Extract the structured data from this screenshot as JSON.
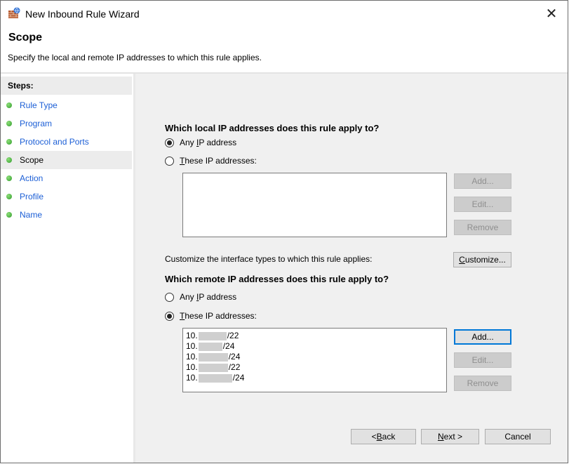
{
  "window": {
    "title": "New Inbound Rule Wizard"
  },
  "header": {
    "title": "Scope",
    "description": "Specify the local and remote IP addresses to which this rule applies."
  },
  "steps": {
    "heading": "Steps:",
    "items": [
      {
        "label": "Rule Type"
      },
      {
        "label": "Program"
      },
      {
        "label": "Protocol and Ports"
      },
      {
        "label": "Scope"
      },
      {
        "label": "Action"
      },
      {
        "label": "Profile"
      },
      {
        "label": "Name"
      }
    ],
    "current": "Scope"
  },
  "local": {
    "question": "Which local IP addresses does this rule apply to?",
    "any_prefix": "Any ",
    "any_u": "I",
    "any_suffix": "P address",
    "these_prefix": "",
    "these_u": "T",
    "these_suffix": "hese IP addresses:",
    "selected": "any",
    "buttons": {
      "add": "Add...",
      "edit": "Edit...",
      "remove": "Remove"
    }
  },
  "customize": {
    "text": "Customize the interface types to which this rule applies:",
    "button_u": "C",
    "button_rest": "ustomize..."
  },
  "remote": {
    "question": "Which remote IP addresses does this rule apply to?",
    "any_prefix": "Any ",
    "any_u": "I",
    "any_suffix": "P address",
    "these_u": "T",
    "these_suffix": "hese IP addresses:",
    "selected": "these",
    "addresses": [
      {
        "prefix": "10.",
        "suffix": "/22"
      },
      {
        "prefix": "10.",
        "suffix": "/24"
      },
      {
        "prefix": "10.",
        "suffix": "/24"
      },
      {
        "prefix": "10.",
        "suffix": "/22"
      },
      {
        "prefix": "10.",
        "suffix": "/24"
      }
    ],
    "buttons": {
      "add": "Add...",
      "edit": "Edit...",
      "remove": "Remove"
    }
  },
  "footer": {
    "back_prefix": "< ",
    "back_u": "B",
    "back_rest": "ack",
    "next_u": "N",
    "next_rest": "ext >",
    "cancel": "Cancel"
  }
}
